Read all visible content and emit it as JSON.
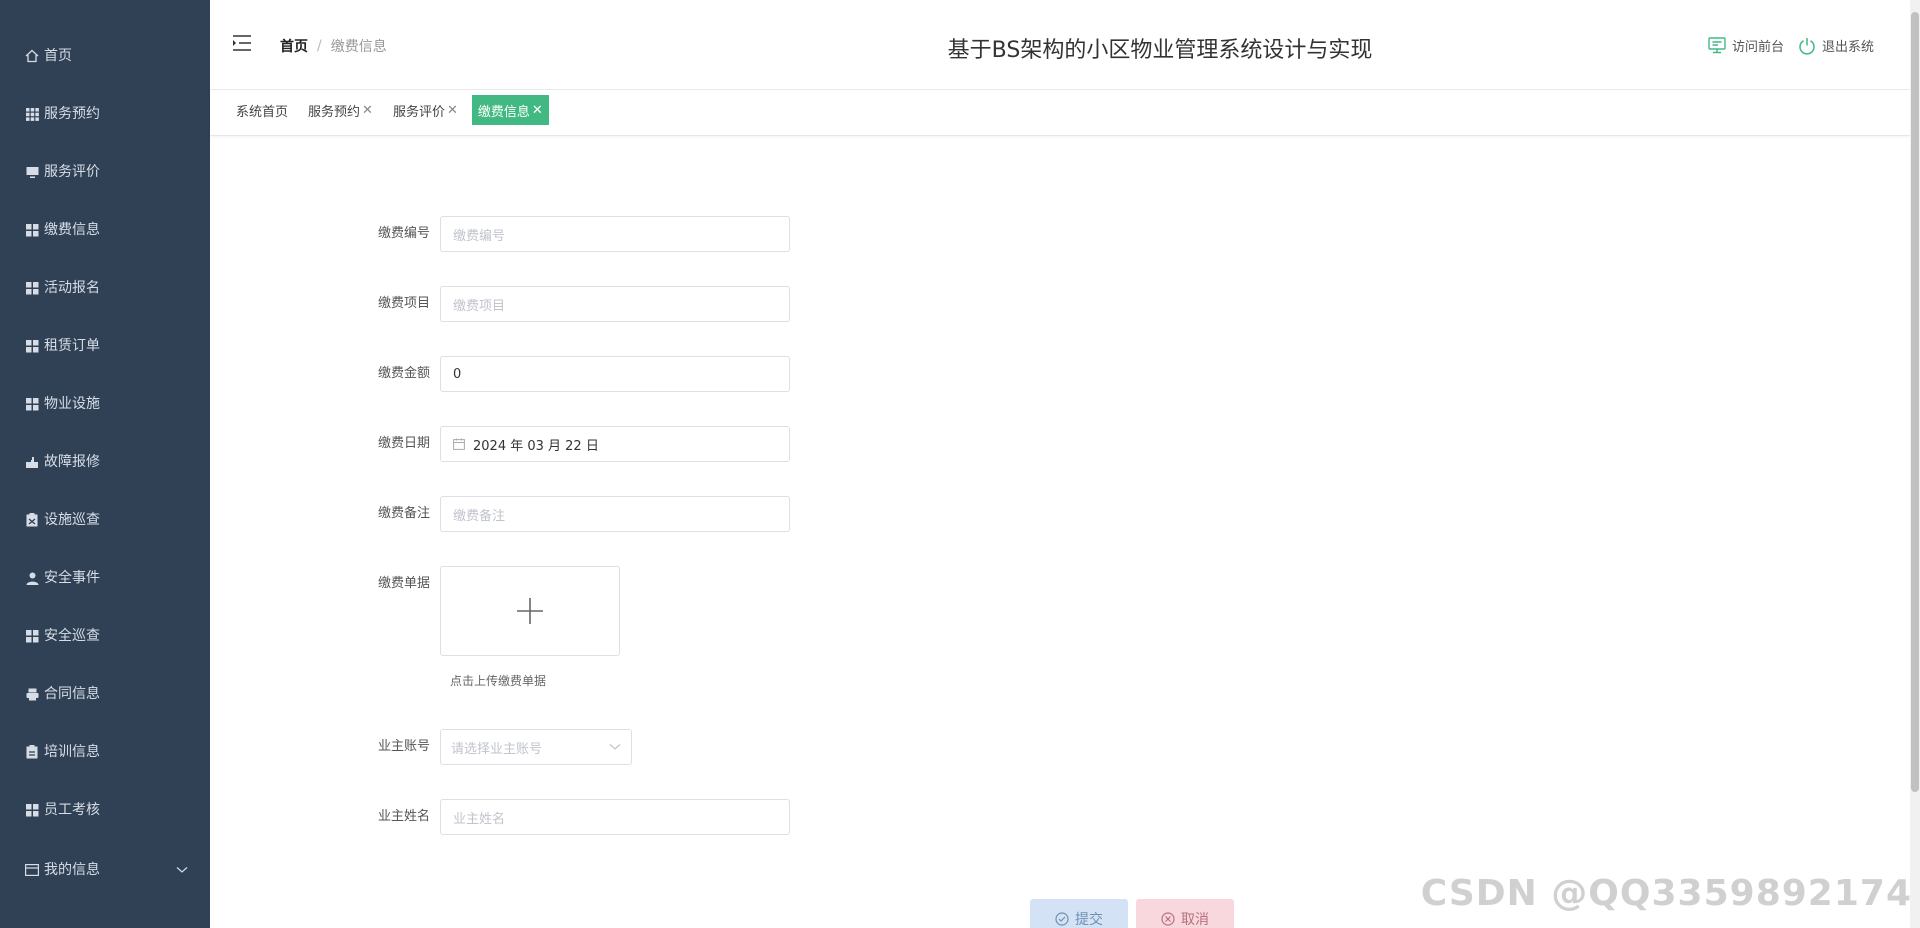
{
  "sidebar": {
    "items": [
      {
        "label": "首页",
        "icon": "home-icon"
      },
      {
        "label": "服务预约",
        "icon": "grid-icon"
      },
      {
        "label": "服务评价",
        "icon": "monitor-icon"
      },
      {
        "label": "缴费信息",
        "icon": "grid-icon"
      },
      {
        "label": "活动报名",
        "icon": "grid-icon"
      },
      {
        "label": "租赁订单",
        "icon": "grid-icon"
      },
      {
        "label": "物业设施",
        "icon": "grid-icon"
      },
      {
        "label": "故障报修",
        "icon": "wrench-icon"
      },
      {
        "label": "设施巡查",
        "icon": "clipboard-icon"
      },
      {
        "label": "安全事件",
        "icon": "user-icon"
      },
      {
        "label": "安全巡查",
        "icon": "grid-icon"
      },
      {
        "label": "合同信息",
        "icon": "printer-icon"
      },
      {
        "label": "培训信息",
        "icon": "clipboard-icon"
      },
      {
        "label": "员工考核",
        "icon": "grid-icon"
      },
      {
        "label": "我的信息",
        "icon": "card-icon"
      }
    ]
  },
  "header": {
    "breadcrumb_home": "首页",
    "breadcrumb_sep": "/",
    "breadcrumb_current": "缴费信息",
    "system_title": "基于BS架构的小区物业管理系统设计与实现",
    "visit_front": "访问前台",
    "logout": "退出系统"
  },
  "tabs": [
    {
      "label": "系统首页",
      "closable": false
    },
    {
      "label": "服务预约",
      "closable": true
    },
    {
      "label": "服务评价",
      "closable": true
    },
    {
      "label": "缴费信息",
      "closable": true,
      "active": true
    }
  ],
  "form": {
    "fee_no": {
      "label": "缴费编号",
      "placeholder": "缴费编号",
      "value": ""
    },
    "fee_item": {
      "label": "缴费项目",
      "placeholder": "缴费项目",
      "value": ""
    },
    "fee_amount": {
      "label": "缴费金额",
      "value": "0"
    },
    "fee_date": {
      "label": "缴费日期",
      "value": "2024 年 03 月 22 日"
    },
    "fee_note": {
      "label": "缴费备注",
      "placeholder": "缴费备注",
      "value": ""
    },
    "fee_receipt": {
      "label": "缴费单据",
      "tip": "点击上传缴费单据"
    },
    "owner_account": {
      "label": "业主账号",
      "placeholder": "请选择业主账号"
    },
    "owner_name": {
      "label": "业主姓名",
      "placeholder": "业主姓名",
      "value": ""
    },
    "submit": "提交",
    "cancel": "取消"
  },
  "watermark": "CSDN @QQ3359892174",
  "colors": {
    "sidebar_bg": "#304156",
    "active_tab": "#42b983",
    "submit_btn": "#d3e3f5",
    "cancel_btn": "#f8d7dd"
  }
}
